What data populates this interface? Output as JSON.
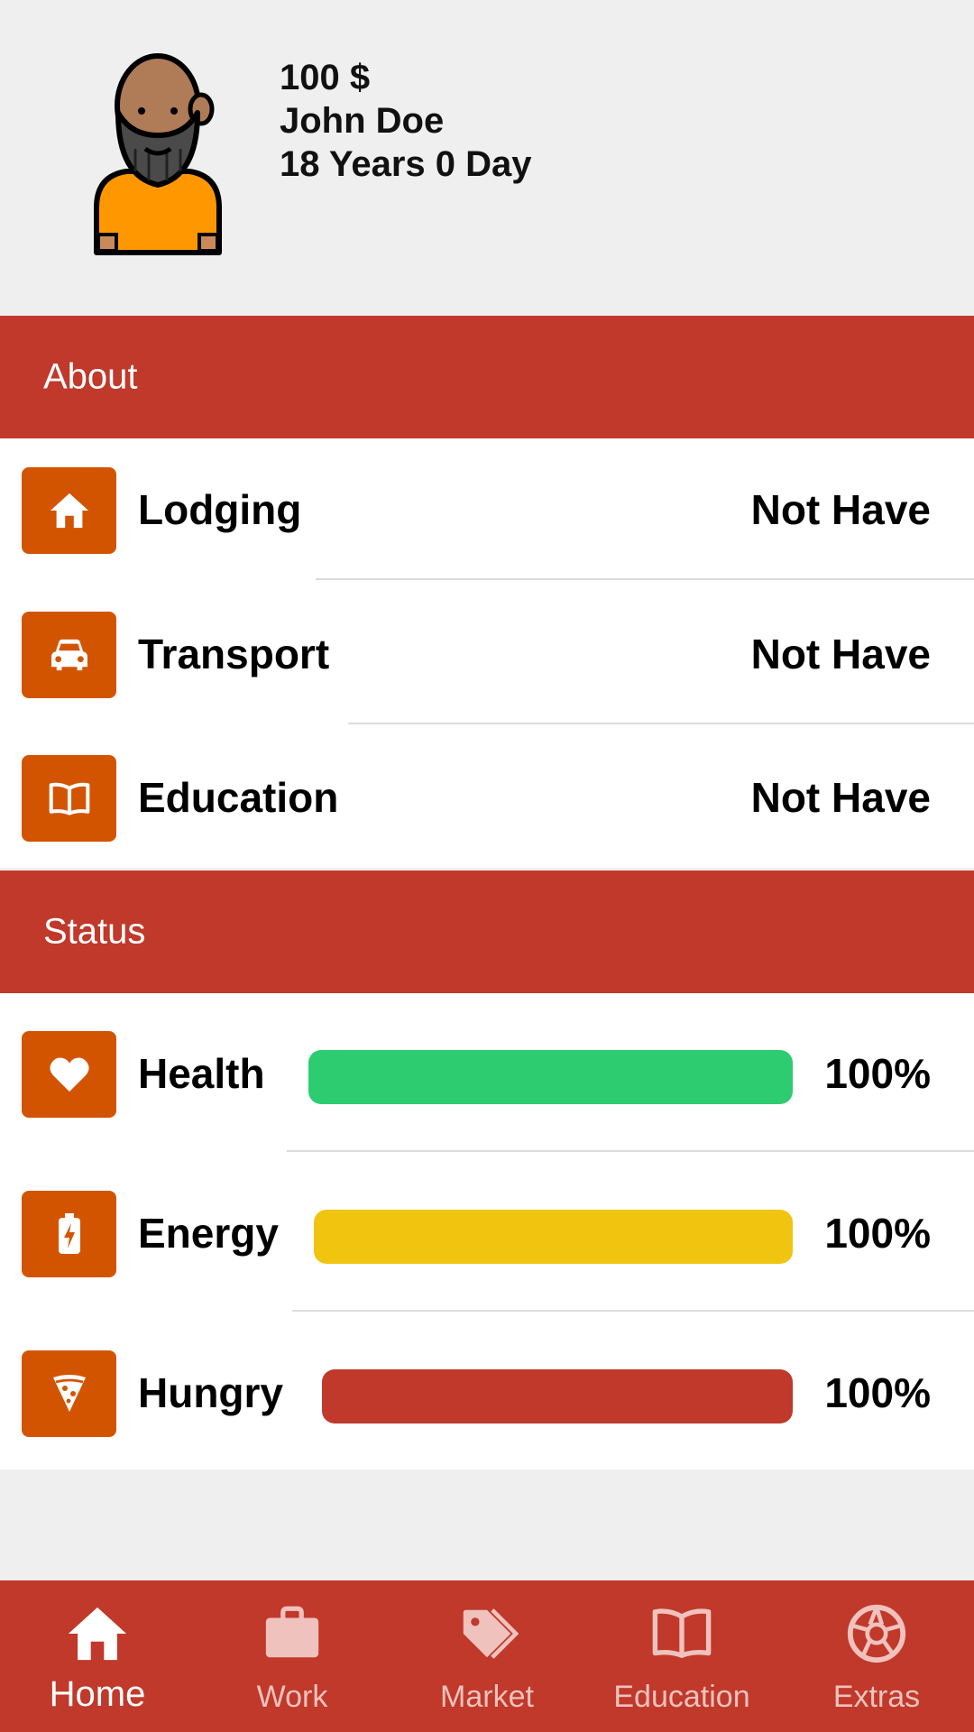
{
  "profile": {
    "money": "100 $",
    "name": "John Doe",
    "age": "18 Years 0 Day",
    "avatar_icon": "bearded-man-avatar-icon"
  },
  "about": {
    "title": "About",
    "items": [
      {
        "label": "Lodging",
        "value": "Not Have",
        "icon": "home-icon"
      },
      {
        "label": "Transport",
        "value": "Not Have",
        "icon": "car-icon"
      },
      {
        "label": "Education",
        "value": "Not Have",
        "icon": "book-icon"
      }
    ]
  },
  "status": {
    "title": "Status",
    "items": [
      {
        "label": "Health",
        "percent": "100%",
        "level": 1.0,
        "color": "#2ecc71",
        "icon": "heart-icon"
      },
      {
        "label": "Energy",
        "percent": "100%",
        "level": 1.0,
        "color": "#f1c40f",
        "icon": "battery-charging-icon"
      },
      {
        "label": "Hungry",
        "percent": "100%",
        "level": 1.0,
        "color": "#c0392b",
        "icon": "pizza-icon"
      }
    ]
  },
  "nav": {
    "items": [
      {
        "label": "Home",
        "icon": "home-icon",
        "active": true
      },
      {
        "label": "Work",
        "icon": "briefcase-icon",
        "active": false
      },
      {
        "label": "Market",
        "icon": "tags-icon",
        "active": false
      },
      {
        "label": "Education",
        "icon": "book-icon",
        "active": false
      },
      {
        "label": "Extras",
        "icon": "aperture-icon",
        "active": false
      }
    ]
  },
  "colors": {
    "primary": "#c0392b",
    "icon_box": "#d35400",
    "background": "#efefef"
  }
}
